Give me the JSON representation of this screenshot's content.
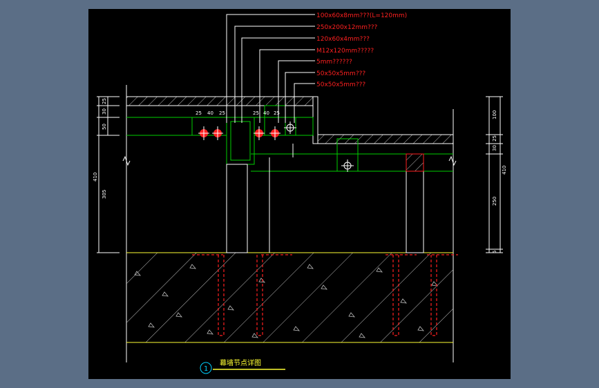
{
  "colors": {
    "background": "#5b6e86",
    "sheet": "#000000",
    "annotation": "#ff2020",
    "dimension": "#ffffff",
    "steel": "#00d000",
    "concrete": "#ffff33",
    "hatch": "#c0c0c0",
    "anchor": "#ff2020",
    "title_circle": "#00d0ff",
    "title_text": "#ffff33"
  },
  "callouts": [
    {
      "text": "100x60x8mm???(L=120mm)"
    },
    {
      "text": "250x200x12mm???"
    },
    {
      "text": "120x60x4mm???"
    },
    {
      "text": "M12x120mm?????"
    },
    {
      "text": "5mm??????"
    },
    {
      "text": "50x50x5mm???"
    },
    {
      "text": "50x50x5mm???"
    }
  ],
  "left_dims": {
    "inner": [
      "25",
      "30",
      "50"
    ],
    "outer": [
      "410",
      "305"
    ]
  },
  "right_dims": {
    "inner": [
      "100",
      "25",
      "30",
      "250",
      "5"
    ],
    "outer": [
      "410"
    ]
  },
  "top_dims": {
    "group1": [
      "25",
      "40",
      "25"
    ],
    "group2": [
      "25",
      "40",
      "25"
    ]
  },
  "title": {
    "number": "1",
    "text": "幕墙节点详图"
  }
}
